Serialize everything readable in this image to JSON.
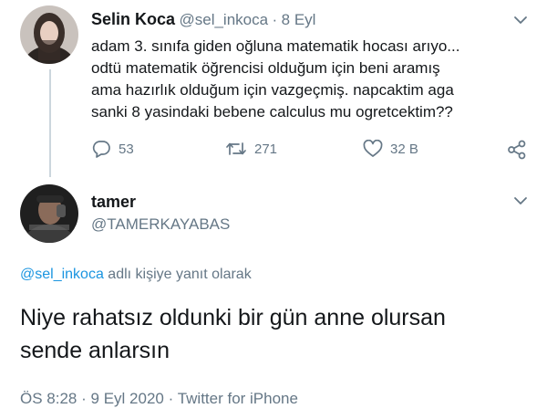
{
  "quoted_tweet": {
    "display_name": "Selin Koca",
    "handle": "@sel_inkoca",
    "separator": "·",
    "date": "8 Eyl",
    "text_lines": [
      "adam 3. sınıfa giden oğluna matematik hocası arıyo...",
      "odtü matematik öğrencisi olduğum için beni aramış",
      "ama hazırlık olduğum için vazgeçmiş. napcaktim aga",
      "sanki 8 yasindaki bebene calculus mu ogretcektim??"
    ],
    "actions": {
      "replies": "53",
      "retweets": "271",
      "likes": "32 B"
    }
  },
  "reply_tweet": {
    "display_name": "tamer",
    "handle": "@TAMERKAYABAS",
    "reply_to_handle": "@sel_inkoca",
    "reply_to_suffix": "adlı kişiye yanıt olarak",
    "text_lines": [
      "Niye rahatsız oldunki bir gün anne olursan",
      "sende anlarsın"
    ],
    "time": "ÖS 8:28",
    "separator": "·",
    "date": "9 Eyl 2020",
    "separator2": "·",
    "source": "Twitter for iPhone"
  },
  "colors": {
    "text": "#14171a",
    "secondary": "#657786",
    "link": "#1b95e0",
    "thread_line": "#ccd6dd"
  }
}
